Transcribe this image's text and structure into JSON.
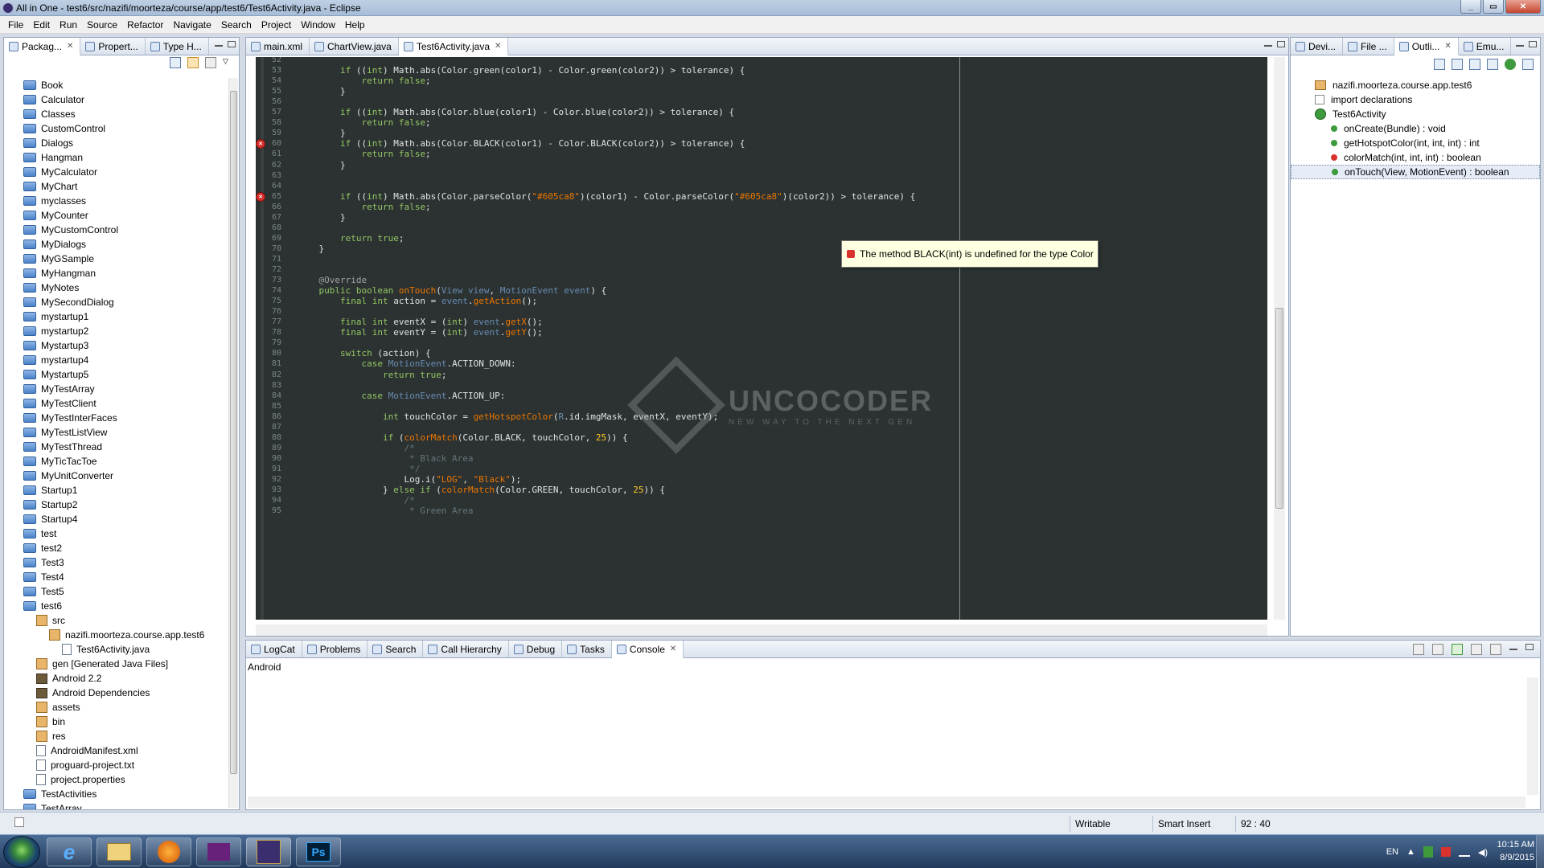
{
  "window": {
    "title": "All in One - test6/src/nazifi/moorteza/course/app/test6/Test6Activity.java - Eclipse"
  },
  "menu": [
    "File",
    "Edit",
    "Run",
    "Source",
    "Refactor",
    "Navigate",
    "Search",
    "Project",
    "Window",
    "Help"
  ],
  "left_tabs": [
    "Packag...",
    "Propert...",
    "Type H..."
  ],
  "tree": [
    {
      "label": "Book",
      "icon": "folder",
      "indent": 0
    },
    {
      "label": "Calculator",
      "icon": "folder",
      "indent": 0
    },
    {
      "label": "Classes",
      "icon": "folder",
      "indent": 0
    },
    {
      "label": "CustomControl",
      "icon": "folder",
      "indent": 0
    },
    {
      "label": "Dialogs",
      "icon": "folder",
      "indent": 0
    },
    {
      "label": "Hangman",
      "icon": "folder",
      "indent": 0
    },
    {
      "label": "MyCalculator",
      "icon": "folder",
      "indent": 0
    },
    {
      "label": "MyChart",
      "icon": "folder",
      "indent": 0
    },
    {
      "label": "myclasses",
      "icon": "folder",
      "indent": 0
    },
    {
      "label": "MyCounter",
      "icon": "folder",
      "indent": 0
    },
    {
      "label": "MyCustomControl",
      "icon": "folder",
      "indent": 0
    },
    {
      "label": "MyDialogs",
      "icon": "folder",
      "indent": 0
    },
    {
      "label": "MyGSample",
      "icon": "folder",
      "indent": 0
    },
    {
      "label": "MyHangman",
      "icon": "folder",
      "indent": 0
    },
    {
      "label": "MyNotes",
      "icon": "folder",
      "indent": 0
    },
    {
      "label": "MySecondDialog",
      "icon": "folder",
      "indent": 0
    },
    {
      "label": "mystartup1",
      "icon": "folder",
      "indent": 0
    },
    {
      "label": "mystartup2",
      "icon": "folder",
      "indent": 0
    },
    {
      "label": "Mystartup3",
      "icon": "folder",
      "indent": 0
    },
    {
      "label": "mystartup4",
      "icon": "folder",
      "indent": 0
    },
    {
      "label": "Mystartup5",
      "icon": "folder",
      "indent": 0
    },
    {
      "label": "MyTestArray",
      "icon": "folder",
      "indent": 0
    },
    {
      "label": "MyTestClient",
      "icon": "folder",
      "indent": 0
    },
    {
      "label": "MyTestInterFaces",
      "icon": "folder",
      "indent": 0
    },
    {
      "label": "MyTestListView",
      "icon": "folder",
      "indent": 0
    },
    {
      "label": "MyTestThread",
      "icon": "folder",
      "indent": 0
    },
    {
      "label": "MyTicTacToe",
      "icon": "folder",
      "indent": 0
    },
    {
      "label": "MyUnitConverter",
      "icon": "folder",
      "indent": 0
    },
    {
      "label": "Startup1",
      "icon": "folder",
      "indent": 0
    },
    {
      "label": "Startup2",
      "icon": "folder",
      "indent": 0
    },
    {
      "label": "Startup4",
      "icon": "folder",
      "indent": 0
    },
    {
      "label": "test",
      "icon": "folder",
      "indent": 0
    },
    {
      "label": "test2",
      "icon": "folder",
      "indent": 0
    },
    {
      "label": "Test3",
      "icon": "folder",
      "indent": 0
    },
    {
      "label": "Test4",
      "icon": "folder",
      "indent": 0
    },
    {
      "label": "Test5",
      "icon": "folder",
      "indent": 0
    },
    {
      "label": "test6",
      "icon": "folder",
      "indent": 0
    },
    {
      "label": "src",
      "icon": "pkg",
      "indent": 1
    },
    {
      "label": "nazifi.moorteza.course.app.test6",
      "icon": "pkg",
      "indent": 2
    },
    {
      "label": "Test6Activity.java",
      "icon": "file",
      "indent": 3
    },
    {
      "label": "gen [Generated Java Files]",
      "icon": "pkg",
      "indent": 1
    },
    {
      "label": "Android 2.2",
      "icon": "lib",
      "indent": 1
    },
    {
      "label": "Android Dependencies",
      "icon": "lib",
      "indent": 1
    },
    {
      "label": "assets",
      "icon": "pkg",
      "indent": 1
    },
    {
      "label": "bin",
      "icon": "pkg",
      "indent": 1
    },
    {
      "label": "res",
      "icon": "pkg",
      "indent": 1
    },
    {
      "label": "AndroidManifest.xml",
      "icon": "file",
      "indent": 1
    },
    {
      "label": "proguard-project.txt",
      "icon": "file",
      "indent": 1
    },
    {
      "label": "project.properties",
      "icon": "file",
      "indent": 1
    },
    {
      "label": "TestActivities",
      "icon": "folder",
      "indent": 0
    },
    {
      "label": "TestArray",
      "icon": "folder",
      "indent": 0
    }
  ],
  "editor_tabs": [
    "main.xml",
    "ChartView.java",
    "Test6Activity.java"
  ],
  "code": [
    {
      "n": "52",
      "t": ""
    },
    {
      "n": "53",
      "t": "        if ((int) Math.abs(Color.green(color1) - Color.green(color2)) > tolerance) {"
    },
    {
      "n": "54",
      "t": "            return false;"
    },
    {
      "n": "55",
      "t": "        }"
    },
    {
      "n": "56",
      "t": ""
    },
    {
      "n": "57",
      "t": "        if ((int) Math.abs(Color.blue(color1) - Color.blue(color2)) > tolerance) {"
    },
    {
      "n": "58",
      "t": "            return false;"
    },
    {
      "n": "59",
      "t": "        }"
    },
    {
      "n": "60",
      "t": "        if ((int) Math.abs(Color.BLACK(color1) - Color.BLACK(color2)) > tolerance) {"
    },
    {
      "n": "61",
      "t": "            return false;"
    },
    {
      "n": "62",
      "t": "        }"
    },
    {
      "n": "63",
      "t": ""
    },
    {
      "n": "64",
      "t": ""
    },
    {
      "n": "65",
      "t": "        if ((int) Math.abs(Color.parseColor(\"#605ca8\")(color1) - Color.parseColor(\"#605ca8\")(color2)) > tolerance) {"
    },
    {
      "n": "66",
      "t": "            return false;"
    },
    {
      "n": "67",
      "t": "        }"
    },
    {
      "n": "68",
      "t": ""
    },
    {
      "n": "69",
      "t": "        return true;"
    },
    {
      "n": "70",
      "t": "    }"
    },
    {
      "n": "71",
      "t": ""
    },
    {
      "n": "72",
      "t": ""
    },
    {
      "n": "73",
      "t": "    @Override"
    },
    {
      "n": "74",
      "t": "    public boolean onTouch(View view, MotionEvent event) {"
    },
    {
      "n": "75",
      "t": "        final int action = event.getAction();"
    },
    {
      "n": "76",
      "t": ""
    },
    {
      "n": "77",
      "t": "        final int eventX = (int) event.getX();"
    },
    {
      "n": "78",
      "t": "        final int eventY = (int) event.getY();"
    },
    {
      "n": "79",
      "t": ""
    },
    {
      "n": "80",
      "t": "        switch (action) {"
    },
    {
      "n": "81",
      "t": "            case MotionEvent.ACTION_DOWN:"
    },
    {
      "n": "82",
      "t": "                return true;"
    },
    {
      "n": "83",
      "t": ""
    },
    {
      "n": "84",
      "t": "            case MotionEvent.ACTION_UP:"
    },
    {
      "n": "85",
      "t": ""
    },
    {
      "n": "86",
      "t": "                int touchColor = getHotspotColor(R.id.imgMask, eventX, eventY);"
    },
    {
      "n": "87",
      "t": ""
    },
    {
      "n": "88",
      "t": "                if (colorMatch(Color.BLACK, touchColor, 25)) {"
    },
    {
      "n": "89",
      "t": "                    /*"
    },
    {
      "n": "90",
      "t": "                     * Black Area"
    },
    {
      "n": "91",
      "t": "                     */"
    },
    {
      "n": "92",
      "t": "                    Log.i(\"LOG\", \"Black\");"
    },
    {
      "n": "93",
      "t": "                } else if (colorMatch(Color.GREEN, touchColor, 25)) {"
    },
    {
      "n": "94",
      "t": "                    /*"
    },
    {
      "n": "95",
      "t": "                     * Green Area"
    }
  ],
  "tooltip": "The method BLACK(int) is undefined for the type Color",
  "watermark": {
    "title": "UNCOCODER",
    "subtitle": "NEW WAY TO THE NEXT GEN"
  },
  "right_tabs": [
    "Devi...",
    "File ...",
    "Outli...",
    "Emu..."
  ],
  "outline": [
    {
      "label": "nazifi.moorteza.course.app.test6",
      "icon": "pkg",
      "indent": 0
    },
    {
      "label": "import declarations",
      "icon": "import",
      "indent": 0
    },
    {
      "label": "Test6Activity",
      "icon": "class",
      "indent": 0
    },
    {
      "label": "onCreate(Bundle) : void",
      "icon": "method",
      "indent": 1
    },
    {
      "label": "getHotspotColor(int, int, int) : int",
      "icon": "method",
      "indent": 1
    },
    {
      "label": "colorMatch(int, int, int) : boolean",
      "icon": "method-error",
      "indent": 1
    },
    {
      "label": "onTouch(View, MotionEvent) : boolean",
      "icon": "method",
      "indent": 1
    }
  ],
  "bottom_tabs": [
    "LogCat",
    "Problems",
    "Search",
    "Call Hierarchy",
    "Debug",
    "Tasks",
    "Console"
  ],
  "console": {
    "label": "Android"
  },
  "status": {
    "writable": "Writable",
    "insert_mode": "Smart Insert",
    "position": "92 : 40"
  },
  "taskbar": {
    "lang": "EN",
    "time": "10:15 AM",
    "date": "8/9/2015",
    "ps_label": "Ps"
  }
}
